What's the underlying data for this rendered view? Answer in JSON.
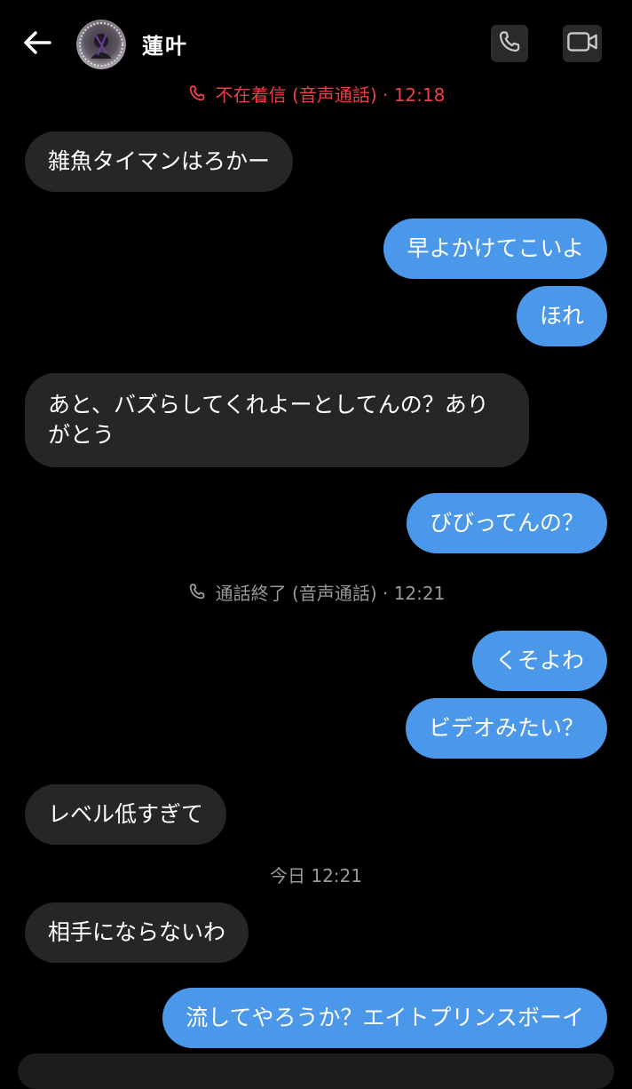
{
  "header": {
    "contact_name": "蓮叶",
    "back_icon": "arrow-left-icon",
    "call_icon": "phone-icon",
    "video_icon": "video-camera-icon"
  },
  "events": {
    "missed_call": "不在着信 (音声通話) · 12:18",
    "call_ended": "通話終了 (音声通話) · 12:21",
    "date_separator": "今日 12:21"
  },
  "messages": [
    {
      "side": "received",
      "text": "雑魚タイマンはろかー"
    },
    {
      "side": "sent",
      "text": "早よかけてこいよ"
    },
    {
      "side": "sent",
      "text": "ほれ"
    },
    {
      "side": "received",
      "text": "あと、バズらしてくれよーとしてんの？ありがとう"
    },
    {
      "side": "sent",
      "text": "びびってんの？"
    },
    {
      "side": "sent",
      "text": "くそよわ"
    },
    {
      "side": "sent",
      "text": "ビデオみたい？"
    },
    {
      "side": "received",
      "text": "レベル低すぎて"
    },
    {
      "side": "received",
      "text": "相手にならないわ"
    },
    {
      "side": "sent",
      "text": "流してやろうか？エイトプリンスボーイ"
    }
  ],
  "colors": {
    "background": "#000000",
    "sent_bubble": "#4b98ea",
    "received_bubble": "#262628",
    "missed_call": "#ee3f46",
    "muted_text": "#9a9a9e"
  }
}
